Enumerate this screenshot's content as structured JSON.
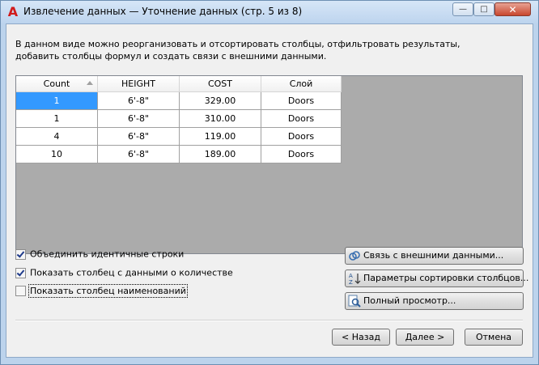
{
  "window": {
    "title": "Извлечение данных — Уточнение данных (стр. 5 из 8)",
    "min_glyph": "—",
    "max_glyph": "□",
    "close_glyph": "✕",
    "app_glyph": "A"
  },
  "description": "В данном виде можно реорганизовать и отсортировать столбцы, отфильтровать результаты, добавить столбцы формул и создать связи с внешними данными.",
  "table": {
    "columns": [
      "Count",
      "HEIGHT",
      "COST",
      "Слой"
    ],
    "rows": [
      [
        "1",
        "6'-8\"",
        "329.00",
        "Doors"
      ],
      [
        "1",
        "6'-8\"",
        "310.00",
        "Doors"
      ],
      [
        "4",
        "6'-8\"",
        "119.00",
        "Doors"
      ],
      [
        "10",
        "6'-8\"",
        "189.00",
        "Doors"
      ]
    ]
  },
  "options": {
    "combine_rows": {
      "label": "Объединить идентичные строки",
      "checked": true
    },
    "show_count": {
      "label": "Показать столбец с данными о количестве",
      "checked": true
    },
    "show_names": {
      "label": "Показать столбец наименований",
      "checked": false
    }
  },
  "side_buttons": {
    "link": "Связь с внешними данными...",
    "sort": "Параметры сортировки столбцов...",
    "preview": "Полный просмотр..."
  },
  "footer": {
    "back": "< Назад",
    "next": "Далее >",
    "cancel": "Отмена"
  },
  "colors": {
    "selection": "#3399ff",
    "grid_background": "#ababab",
    "title_gradient": "#bdd4ee"
  }
}
